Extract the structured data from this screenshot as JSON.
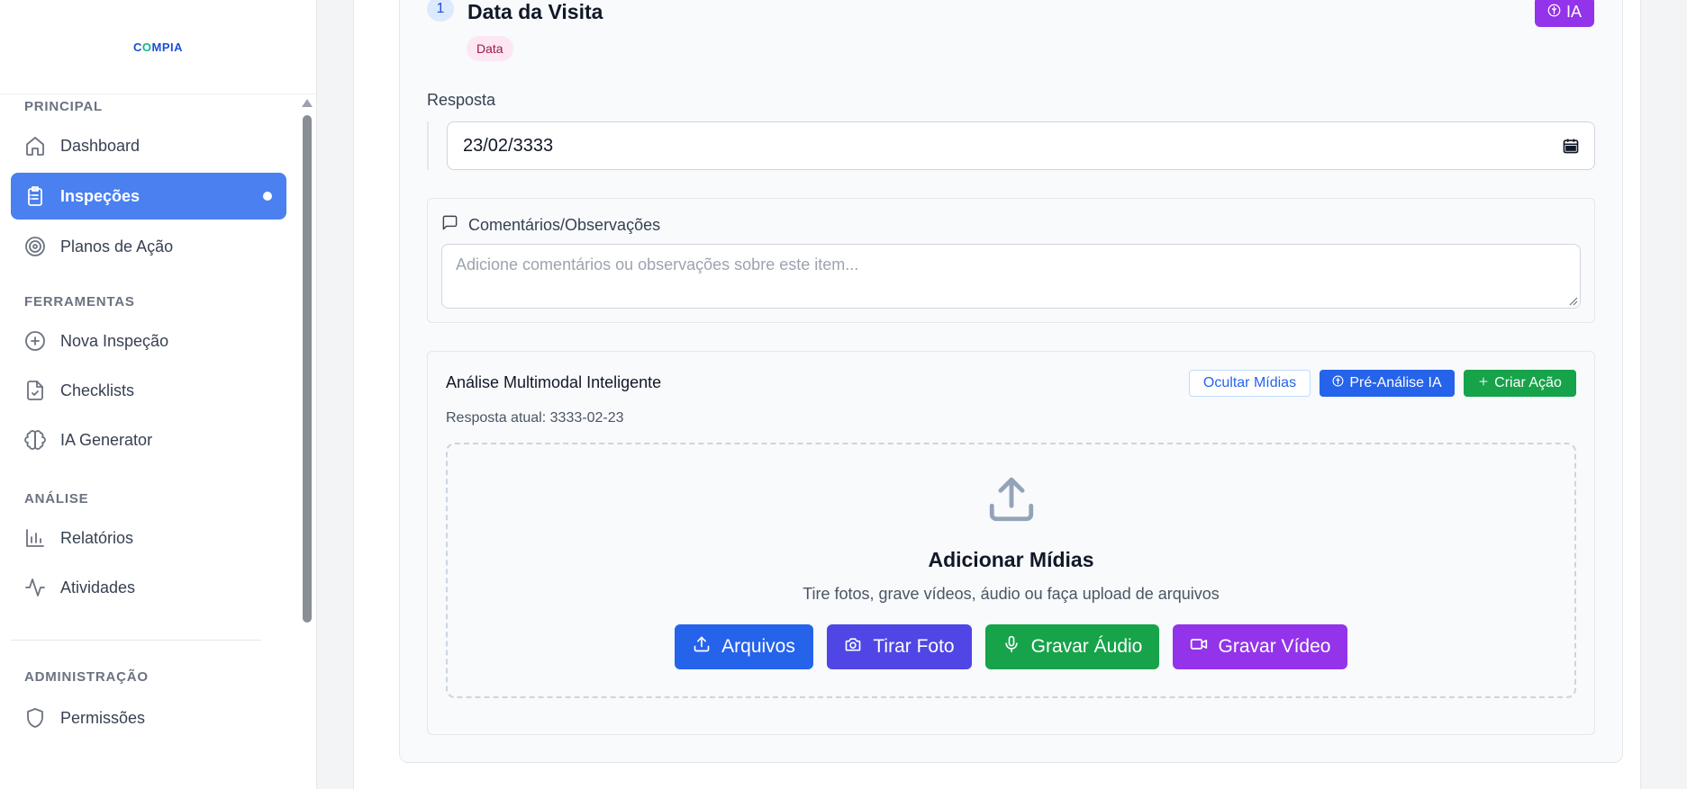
{
  "sidebar": {
    "logo": "COMPIA",
    "sections": {
      "principal": "PRINCIPAL",
      "ferramentas": "FERRAMENTAS",
      "analise": "ANÁLISE",
      "administracao": "ADMINISTRAÇÃO"
    },
    "items": {
      "dashboard": {
        "label": "Dashboard",
        "icon": "home-icon"
      },
      "inspecoes": {
        "label": "Inspeções",
        "icon": "clipboard-list-icon",
        "active": true
      },
      "planos": {
        "label": "Planos de Ação",
        "icon": "target-icon"
      },
      "nova": {
        "label": "Nova Inspeção",
        "icon": "plus-circle-icon"
      },
      "checklists": {
        "label": "Checklists",
        "icon": "file-check-icon"
      },
      "ia": {
        "label": "IA Generator",
        "icon": "brain-icon"
      },
      "relatorios": {
        "label": "Relatórios",
        "icon": "bar-chart-icon"
      },
      "atividades": {
        "label": "Atividades",
        "icon": "activity-icon"
      },
      "permissoes": {
        "label": "Permissões",
        "icon": "shield-icon"
      }
    }
  },
  "question": {
    "number": "1",
    "title": "Data da Visita",
    "type_tag": "Data",
    "ia_badge": "IA",
    "response_label": "Resposta",
    "response_value": "23/02/3333"
  },
  "comments": {
    "title": "Comentários/Observações",
    "placeholder": "Adicione comentários ou observações sobre este item..."
  },
  "multimodal": {
    "title": "Análise Multimodal Inteligente",
    "current_label": "Resposta atual:",
    "current_value": "3333-02-23",
    "hide_media": "Ocultar Mídias",
    "pre_analysis": "Pré-Análise IA",
    "create_action": "Criar Ação",
    "drop_title": "Adicionar Mídias",
    "drop_subtitle": "Tire fotos, grave vídeos, áudio ou faça upload de arquivos",
    "buttons": {
      "files": "Arquivos",
      "photo": "Tirar Foto",
      "audio": "Gravar Áudio",
      "video": "Gravar Vídeo"
    }
  },
  "colors": {
    "active_nav": "#4a80f0",
    "ia_purple": "#9333ea",
    "primary_blue": "#2563eb",
    "indigo": "#4f46e5",
    "green": "#16a34a"
  }
}
